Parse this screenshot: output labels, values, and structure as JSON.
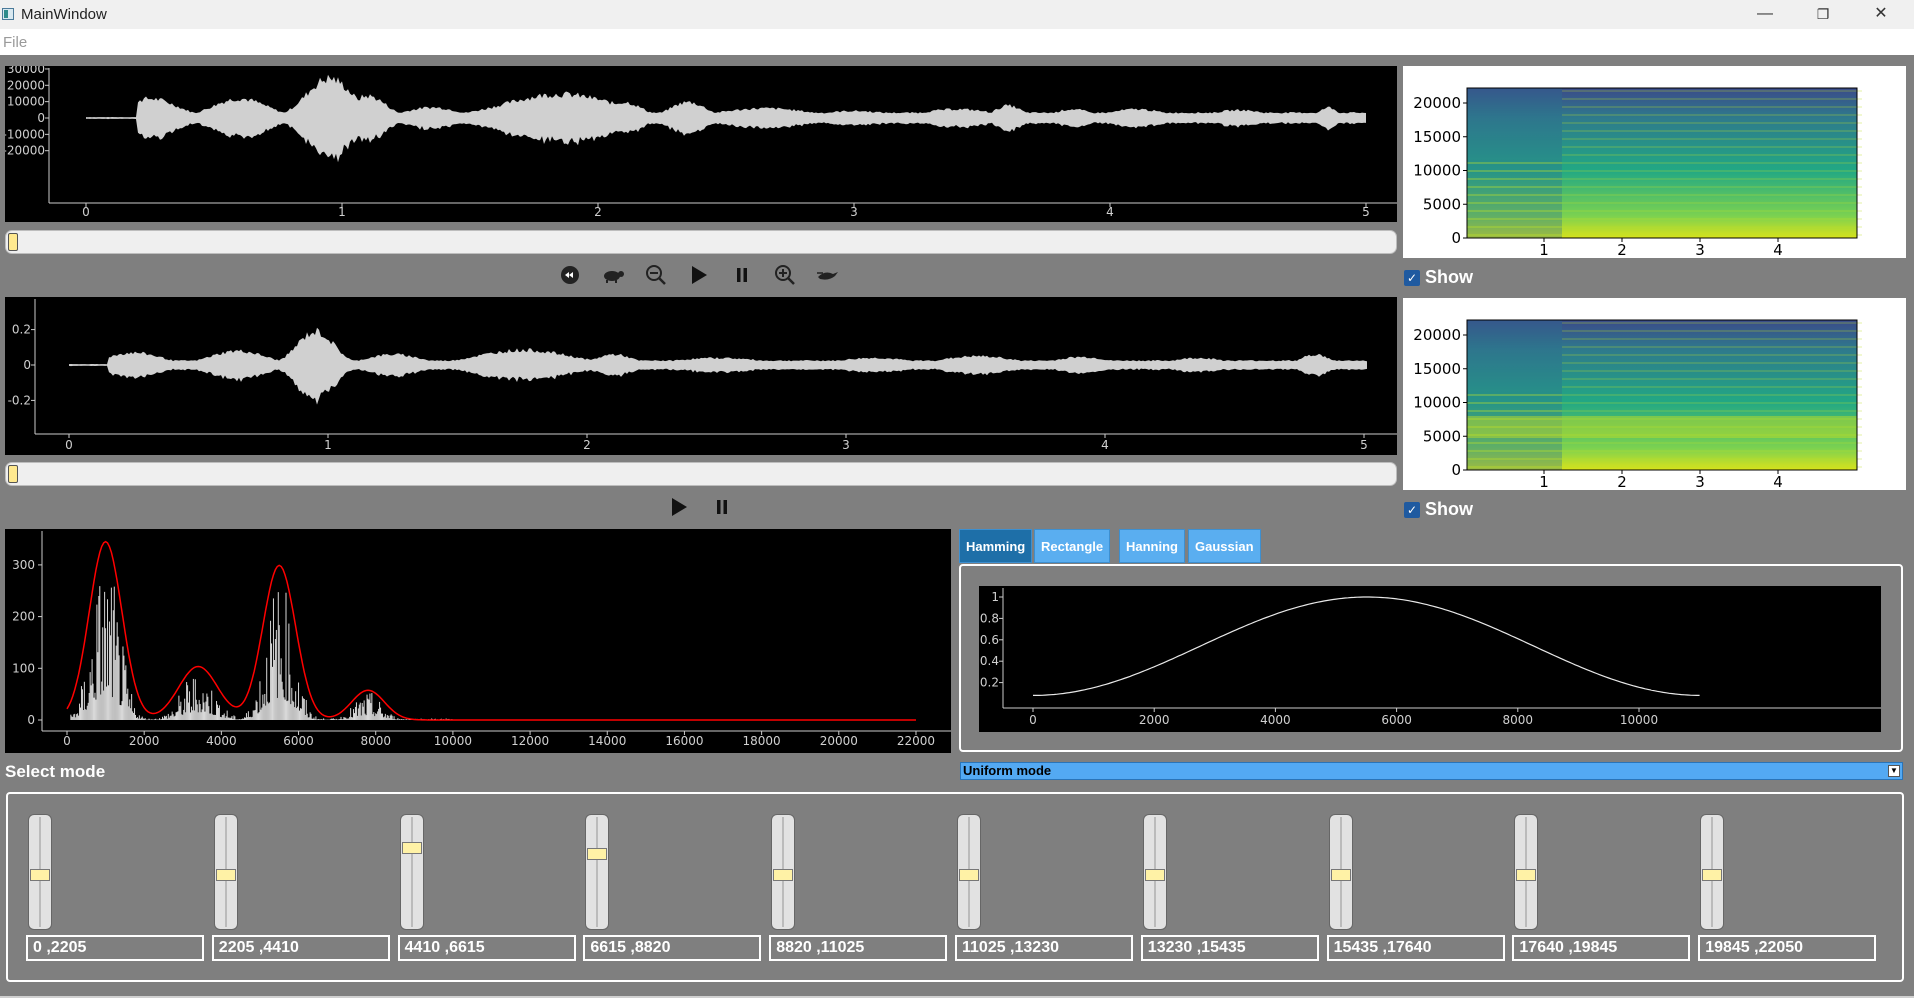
{
  "window": {
    "title": "MainWindow",
    "minimize": "—",
    "restore": "❐",
    "close": "✕"
  },
  "menu": {
    "file": "File"
  },
  "colors": {
    "background": "#7f7f7f",
    "waveform": "#d0d0d0",
    "accent": "#53a9f3",
    "envelope": "#ff0000",
    "slider_handle": "#fff2a6",
    "spectrogram_low": "#3f2a7a",
    "spectrogram_high": "#e3e418"
  },
  "signal1": {
    "yticks": [
      "30000",
      "20000",
      "10000",
      "0",
      "-10000",
      "-20000"
    ],
    "xticks": [
      "0",
      "1",
      "2",
      "3",
      "4",
      "5"
    ],
    "scroll_value": 0
  },
  "signal2": {
    "yticks": [
      "0.2",
      "0",
      "-0.2"
    ],
    "xticks": [
      "0",
      "1",
      "2",
      "3",
      "4",
      "5"
    ],
    "scroll_value": 0
  },
  "toolbar1": {
    "icons": [
      "rewind-icon",
      "slow-down-icon",
      "zoom-out-icon",
      "play-icon",
      "pause-icon",
      "zoom-in-icon",
      "speed-up-icon"
    ]
  },
  "toolbar2": {
    "icons": [
      "play-icon",
      "pause-icon"
    ]
  },
  "spectrogram1": {
    "yticks": [
      "20000",
      "15000",
      "10000",
      "5000",
      "0"
    ],
    "xticks": [
      "1",
      "2",
      "3",
      "4"
    ],
    "show_label": "Show",
    "checked": true
  },
  "spectrogram2": {
    "yticks": [
      "20000",
      "15000",
      "10000",
      "5000",
      "0"
    ],
    "xticks": [
      "1",
      "2",
      "3",
      "4"
    ],
    "show_label": "Show",
    "checked": true
  },
  "spectrum": {
    "yticks": [
      "300",
      "200",
      "100",
      "0"
    ],
    "xticks": [
      "0",
      "2000",
      "4000",
      "6000",
      "8000",
      "10000",
      "12000",
      "14000",
      "16000",
      "18000",
      "20000",
      "22000"
    ]
  },
  "window_tabs": {
    "tabs": [
      "Hamming",
      "Rectangle",
      "Hanning",
      "Gaussian"
    ],
    "selected": 0
  },
  "window_plot": {
    "yticks": [
      "1",
      "0.8",
      "0.6",
      "0.4",
      "0.2"
    ],
    "xticks": [
      "0",
      "2000",
      "4000",
      "6000",
      "8000",
      "10000"
    ]
  },
  "mode": {
    "label": "Select mode",
    "selected": "Uniform mode"
  },
  "equalizer": {
    "bands": [
      {
        "range": "0 ,2205",
        "level": 0.5
      },
      {
        "range": "2205 ,4410",
        "level": 0.5
      },
      {
        "range": "4410 ,6615",
        "level": 0.76
      },
      {
        "range": "6615 ,8820",
        "level": 0.7
      },
      {
        "range": "8820 ,11025",
        "level": 0.5
      },
      {
        "range": "11025 ,13230",
        "level": 0.5
      },
      {
        "range": "13230 ,15435",
        "level": 0.5
      },
      {
        "range": "15435 ,17640",
        "level": 0.5
      },
      {
        "range": "17640 ,19845",
        "level": 0.5
      },
      {
        "range": "19845 ,22050",
        "level": 0.5
      }
    ]
  }
}
